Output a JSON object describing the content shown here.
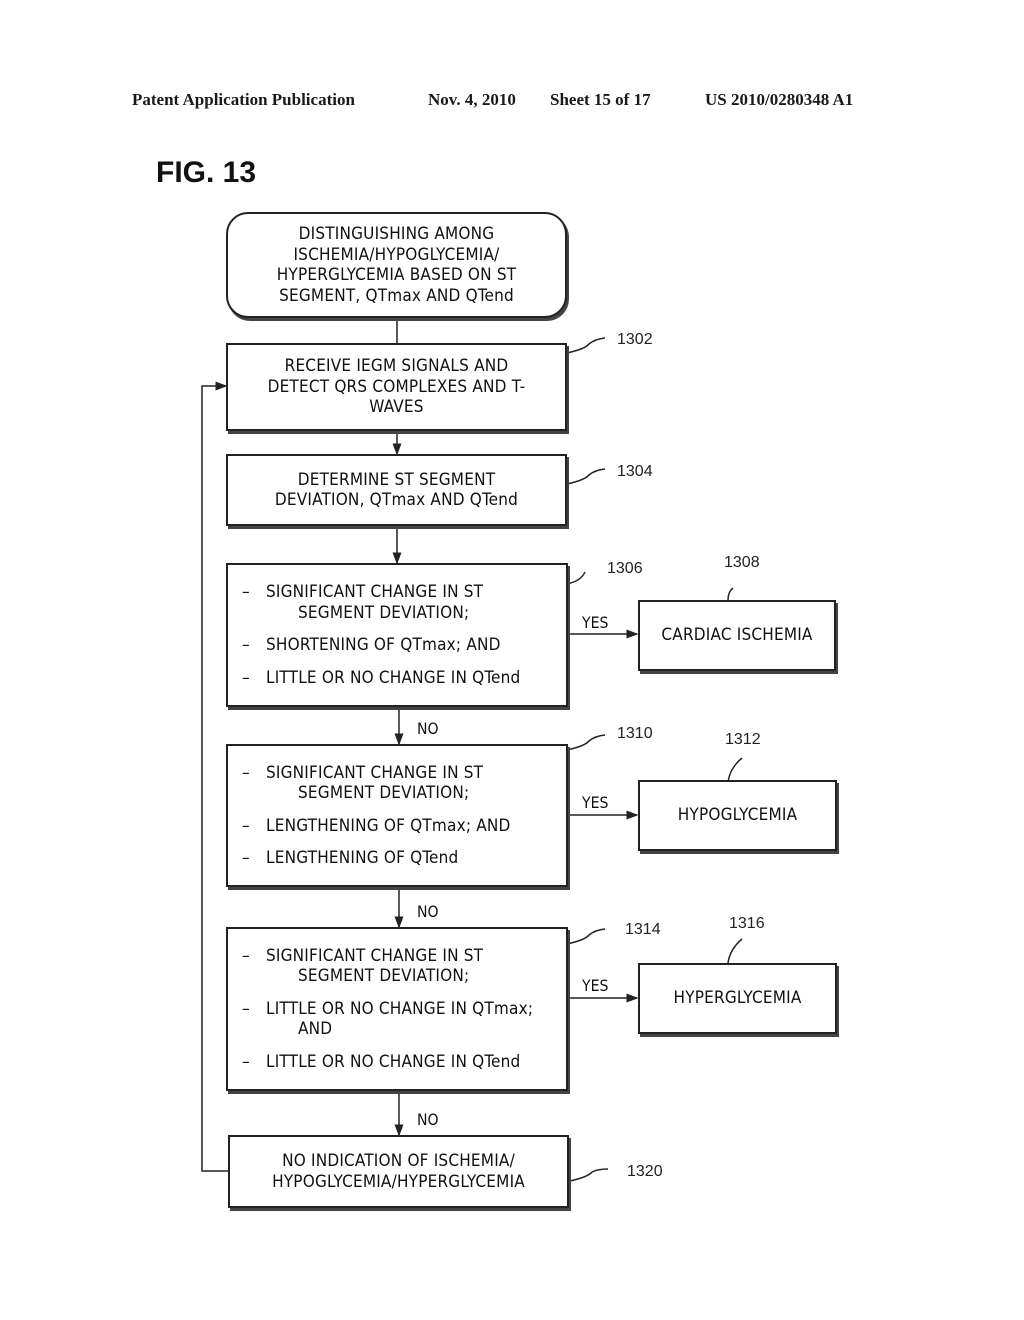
{
  "header": {
    "publication": "Patent Application Publication",
    "date": "Nov. 4, 2010",
    "sheet": "Sheet 15 of 17",
    "number": "US 2010/0280348 A1"
  },
  "figure_label": "FIG. 13",
  "flowchart": {
    "start": {
      "lines": [
        "DISTINGUISHING AMONG",
        "ISCHEMIA/HYPOGLYCEMIA/",
        "HYPERGLYCEMIA BASED ON ST",
        "SEGMENT, QTmax AND QTend"
      ]
    },
    "step_1302": {
      "ref": "1302",
      "lines": [
        "RECEIVE IEGM SIGNALS AND",
        "DETECT QRS COMPLEXES AND T-",
        "WAVES"
      ]
    },
    "step_1304": {
      "ref": "1304",
      "lines": [
        "DETERMINE ST SEGMENT",
        "DEVIATION, QTmax AND QTend"
      ]
    },
    "decision_1306": {
      "ref": "1306",
      "items": [
        {
          "dash": "–",
          "text": "SIGNIFICANT CHANGE IN ST",
          "cont": "SEGMENT DEVIATION;"
        },
        {
          "dash": "–",
          "text": "SHORTENING OF QTmax; AND",
          "cont": ""
        },
        {
          "dash": "–",
          "text": "LITTLE OR NO CHANGE IN QTend",
          "cont": ""
        }
      ]
    },
    "result_1308": {
      "ref": "1308",
      "label": "CARDIAC ISCHEMIA"
    },
    "decision_1310": {
      "ref": "1310",
      "items": [
        {
          "dash": "–",
          "text": "SIGNIFICANT CHANGE IN ST",
          "cont": "SEGMENT DEVIATION;"
        },
        {
          "dash": "–",
          "text": "LENGTHENING OF QTmax; AND",
          "cont": ""
        },
        {
          "dash": "–",
          "text": "LENGTHENING OF QTend",
          "cont": ""
        }
      ]
    },
    "result_1312": {
      "ref": "1312",
      "label": "HYPOGLYCEMIA"
    },
    "decision_1314": {
      "ref": "1314",
      "items": [
        {
          "dash": "–",
          "text": "SIGNIFICANT CHANGE IN ST",
          "cont": "SEGMENT DEVIATION;"
        },
        {
          "dash": "–",
          "text": "LITTLE OR NO CHANGE IN QTmax;",
          "cont": "AND"
        },
        {
          "dash": "–",
          "text": "LITTLE OR NO CHANGE IN QTend",
          "cont": ""
        }
      ]
    },
    "result_1316": {
      "ref": "1316",
      "label": "HYPERGLYCEMIA"
    },
    "end_1320": {
      "ref": "1320",
      "lines": [
        "NO INDICATION OF ISCHEMIA/",
        "HYPOGLYCEMIA/HYPERGLYCEMIA"
      ]
    },
    "yes_label": "YES",
    "no_label": "NO"
  }
}
